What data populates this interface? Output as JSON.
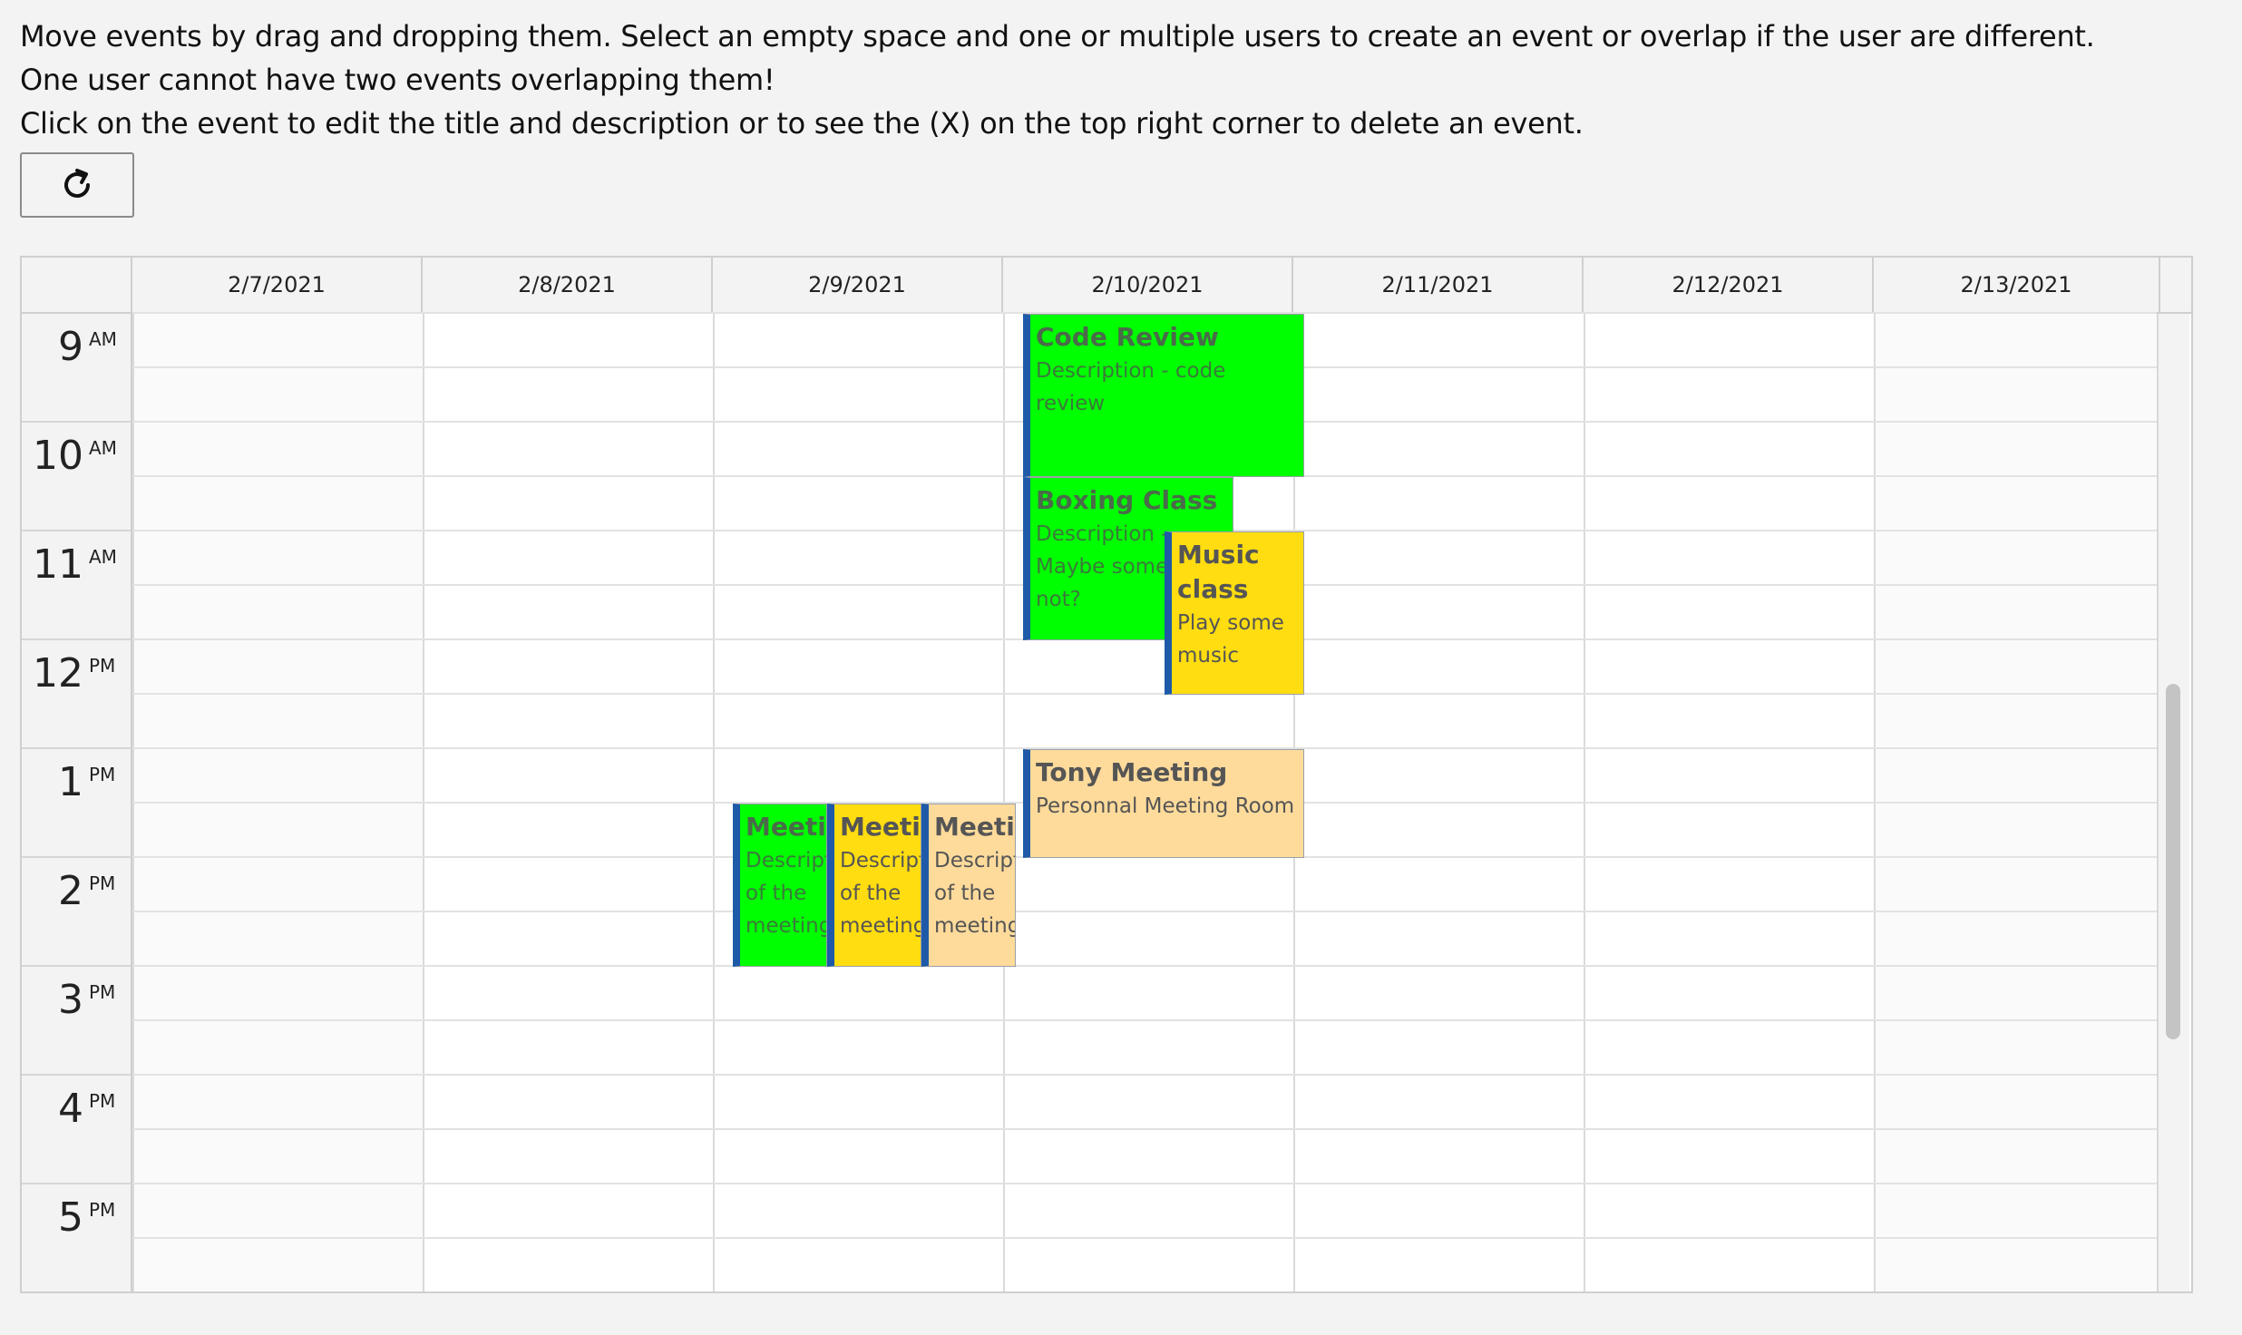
{
  "instructions": {
    "line1": "Move events by drag and dropping them. Select an empty space and one or multiple users to create an event or overlap if the user are different.",
    "line2": "One user cannot have two events overlapping them!",
    "line3": "Click on the event to edit the title and description or to see the (X) on the top right corner to delete an event."
  },
  "toolbar": {
    "refresh_icon": "refresh-icon"
  },
  "calendar": {
    "dates": [
      "2/7/2021",
      "2/8/2021",
      "2/9/2021",
      "2/10/2021",
      "2/11/2021",
      "2/12/2021",
      "2/13/2021"
    ],
    "hours": [
      {
        "h": "9",
        "p": "AM"
      },
      {
        "h": "10",
        "p": "AM"
      },
      {
        "h": "11",
        "p": "AM"
      },
      {
        "h": "12",
        "p": "PM"
      },
      {
        "h": "1",
        "p": "PM"
      },
      {
        "h": "2",
        "p": "PM"
      },
      {
        "h": "3",
        "p": "PM"
      },
      {
        "h": "4",
        "p": "PM"
      },
      {
        "h": "5",
        "p": "PM"
      }
    ],
    "events": [
      {
        "title": "Code Review",
        "desc": "Description - code review",
        "color": "#00ff00"
      },
      {
        "title": "Boxing Class",
        "desc": "Description - Maybe some why not?",
        "color": "#00ff00"
      },
      {
        "title": "Music class",
        "desc": "Play some music",
        "color": "#ffdd11"
      },
      {
        "title": "Tony Meeting",
        "desc": "Personnal Meeting Room",
        "color": "#ffdb9b"
      },
      {
        "title": "Meeting",
        "desc": "Description of the meeting",
        "color": "#00ff00"
      },
      {
        "title": "Meeting",
        "desc": "Description of the meeting",
        "color": "#ffdd11"
      },
      {
        "title": "Meeting",
        "desc": "Description of the meeting",
        "color": "#ffdb9b"
      }
    ]
  },
  "colors": {
    "accent_bar": "#1e5aa8",
    "background": "#f3f3f3"
  }
}
